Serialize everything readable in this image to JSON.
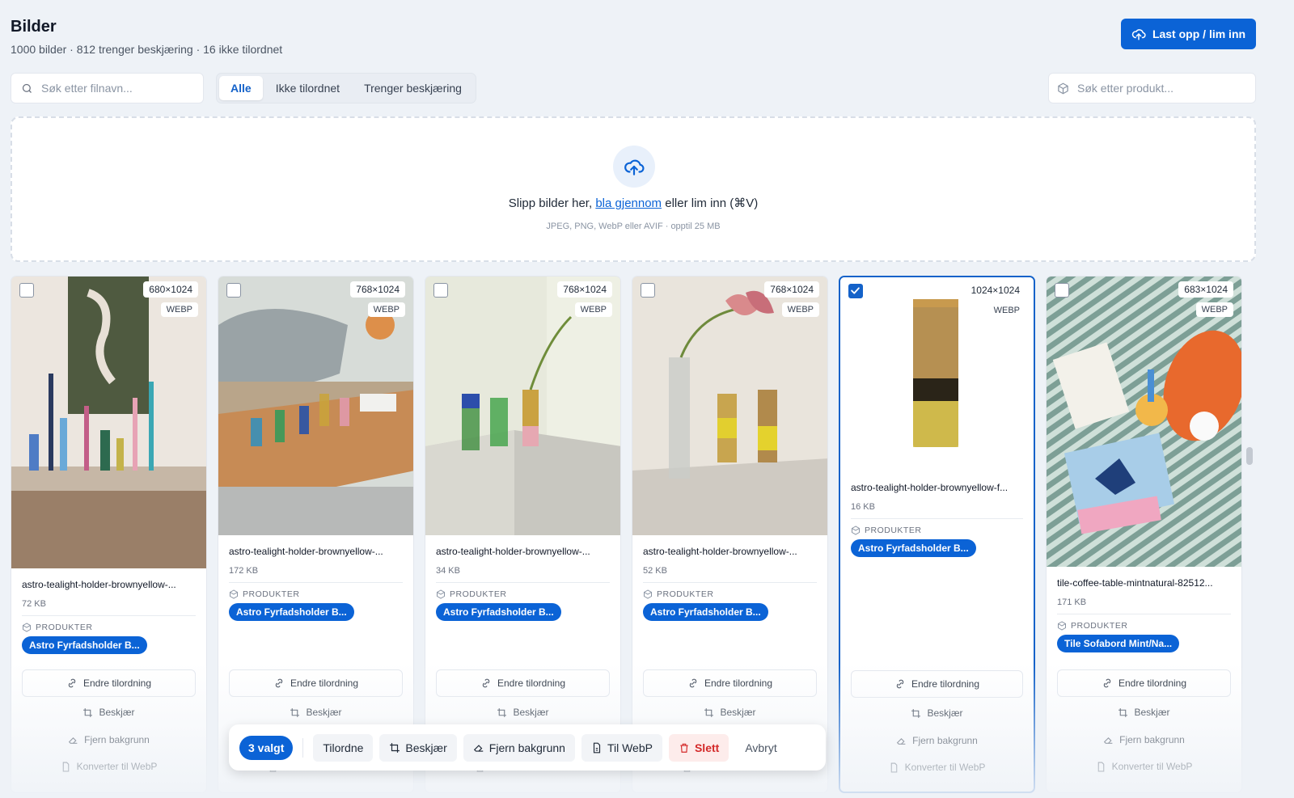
{
  "header": {
    "title": "Bilder",
    "subtitle": "1000 bilder · 812 trenger beskjæring · 16 ikke tilordnet",
    "upload_label": "Last opp / lim inn"
  },
  "search": {
    "placeholder": "Søk etter filnavn..."
  },
  "tabs": [
    {
      "label": "Alle",
      "active": true
    },
    {
      "label": "Ikke tilordnet",
      "active": false
    },
    {
      "label": "Trenger beskjæring",
      "active": false
    }
  ],
  "product_search": {
    "placeholder": "Søk etter produkt..."
  },
  "dropzone": {
    "text_before": "Slipp bilder her, ",
    "link": "bla gjennom",
    "text_after": " eller lim inn (⌘V)",
    "hint": "JPEG, PNG, WebP eller AVIF · opptil 25 MB"
  },
  "labels": {
    "products": "PRODUKTER",
    "reassign": "Endre tilordning",
    "crop": "Beskjær",
    "remove_bg": "Fjern bakgrunn",
    "convert": "Konverter til WebP"
  },
  "cards": [
    {
      "filename": "astro-tealight-holder-brownyellow-...",
      "size": "72 KB",
      "dims": "680×1024",
      "format": "WEBP",
      "product": "Astro Fyrfadsholder B...",
      "checked": false
    },
    {
      "filename": "astro-tealight-holder-brownyellow-...",
      "size": "172 KB",
      "dims": "768×1024",
      "format": "WEBP",
      "product": "Astro Fyrfadsholder B...",
      "checked": false
    },
    {
      "filename": "astro-tealight-holder-brownyellow-...",
      "size": "34 KB",
      "dims": "768×1024",
      "format": "WEBP",
      "product": "Astro Fyrfadsholder B...",
      "checked": false
    },
    {
      "filename": "astro-tealight-holder-brownyellow-...",
      "size": "52 KB",
      "dims": "768×1024",
      "format": "WEBP",
      "product": "Astro Fyrfadsholder B...",
      "checked": false
    },
    {
      "filename": "astro-tealight-holder-brownyellow-f...",
      "size": "16 KB",
      "dims": "1024×1024",
      "format": "WEBP",
      "product": "Astro Fyrfadsholder B...",
      "checked": true
    },
    {
      "filename": "tile-coffee-table-mintnatural-82512...",
      "size": "171 KB",
      "dims": "683×1024",
      "format": "WEBP",
      "product": "Tile Sofabord Mint/Na...",
      "checked": false
    }
  ],
  "bulkbar": {
    "count": "3 valgt",
    "assign": "Tilordne",
    "crop": "Beskjær",
    "remove_bg": "Fjern bakgrunn",
    "webp": "Til WebP",
    "delete": "Slett",
    "cancel": "Avbryt"
  },
  "colors": {
    "accent": "#0b63d6",
    "danger": "#d42a2a"
  }
}
